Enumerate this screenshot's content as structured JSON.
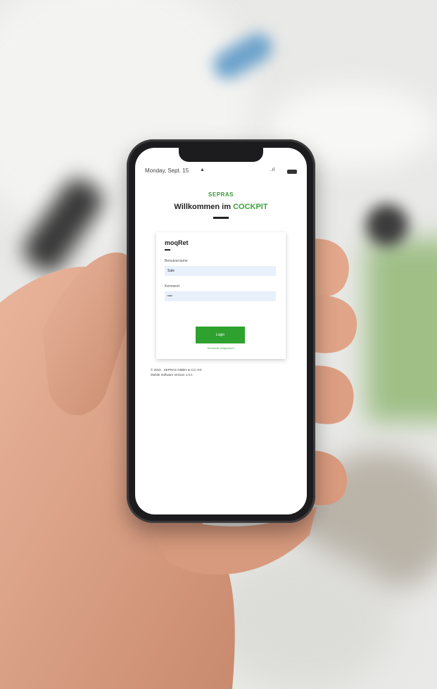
{
  "status_bar": {
    "time": "Monday, Sept. 15",
    "location_glyph": "▲",
    "signal_glyph": "..ıl",
    "battery_glyph": "▬"
  },
  "app": {
    "brand": "SEPRAS",
    "welcome_prefix": "Willkommen im",
    "welcome_accent": "COCKPIT"
  },
  "login_card": {
    "title": "moqRet",
    "username_label": "Benutzername",
    "username_value": "Sale",
    "password_label": "Kennwort",
    "password_value": "••••",
    "login_button": "Login",
    "forgot_link": "Kennwort vergessen?"
  },
  "footer": {
    "line1": "© 2019 · SEPRAS GMBH & CO. KG",
    "line2": "Mobile Software Version 1.0.1"
  },
  "colors": {
    "accent": "#3aa53a",
    "button": "#2fa12f",
    "input_bg": "#e8f0fb",
    "phone_body": "#1c1c1e"
  }
}
